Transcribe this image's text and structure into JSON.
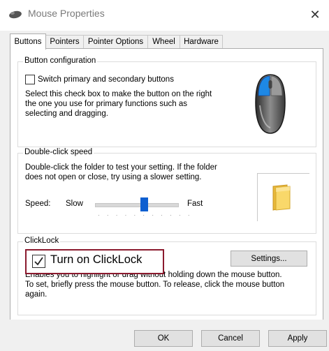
{
  "window": {
    "title": "Mouse Properties",
    "close_glyph": "✕"
  },
  "tabs": [
    {
      "label": "Buttons",
      "active": true
    },
    {
      "label": "Pointers",
      "active": false
    },
    {
      "label": "Pointer Options",
      "active": false
    },
    {
      "label": "Wheel",
      "active": false
    },
    {
      "label": "Hardware",
      "active": false
    }
  ],
  "button_config": {
    "legend": "Button configuration",
    "switch_label": "Switch primary and secondary buttons",
    "switch_checked": false,
    "description_lines": [
      "Select this check box to make the button on the right",
      "the one you use for primary functions such as",
      "selecting and dragging."
    ]
  },
  "double_click": {
    "legend": "Double-click speed",
    "description_lines": [
      "Double-click the folder to test your setting. If the folder",
      "does not open or close, try using a slower setting."
    ],
    "speed_label": "Speed:",
    "slow_label": "Slow",
    "fast_label": "Fast",
    "speed_level_fraction": 0.6
  },
  "clicklock": {
    "legend": "ClickLock",
    "checkbox_label": "Turn on ClickLock",
    "checked": true,
    "settings_label": "Settings...",
    "description_lines": [
      "Enables you to highlight or drag without holding down the mouse button.",
      "To set, briefly press the mouse button. To release, click the mouse button",
      "again."
    ]
  },
  "footer": {
    "ok_label": "OK",
    "cancel_label": "Cancel",
    "apply_label": "Apply"
  },
  "colors": {
    "highlight_border": "#8b1a2e",
    "slider_thumb": "#0e5fd0",
    "mouse_primary_button": "#1e88e5"
  },
  "icons": {
    "title": "mouse-icon",
    "mouse_preview": "mouse-illustration",
    "test_folder": "folder-icon"
  }
}
